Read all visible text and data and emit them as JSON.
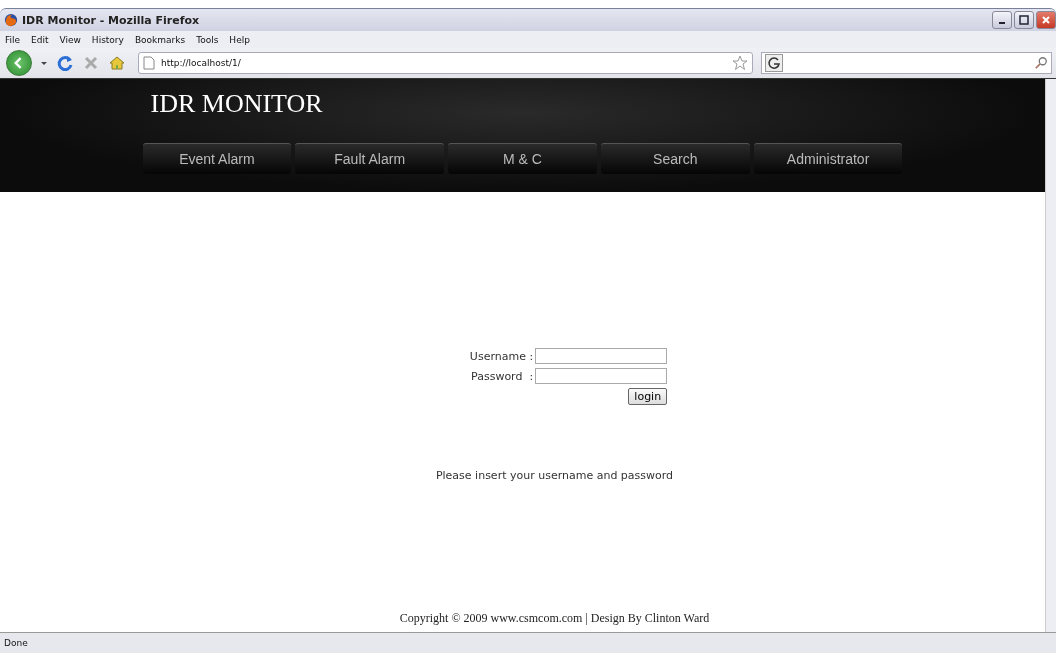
{
  "window": {
    "title": "IDR Monitor - Mozilla Firefox"
  },
  "menu": [
    "File",
    "Edit",
    "View",
    "History",
    "Bookmarks",
    "Tools",
    "Help"
  ],
  "address": {
    "value": "http://localhost/1/"
  },
  "site": {
    "title": "IDR MONITOR",
    "nav": [
      {
        "label": "Event Alarm",
        "selected": false
      },
      {
        "label": "Fault Alarm",
        "selected": false
      },
      {
        "label": "M & C",
        "selected": false
      },
      {
        "label": "Search",
        "selected": false
      },
      {
        "label": "Administrator",
        "selected": false
      }
    ]
  },
  "login": {
    "username_label": "Username :",
    "password_label": "Password  :",
    "button": "login",
    "message": "Please insert your username and password"
  },
  "footer": "Copyright © 2009 www.csmcom.com | Design By Clinton Ward",
  "status_bar": "Done"
}
